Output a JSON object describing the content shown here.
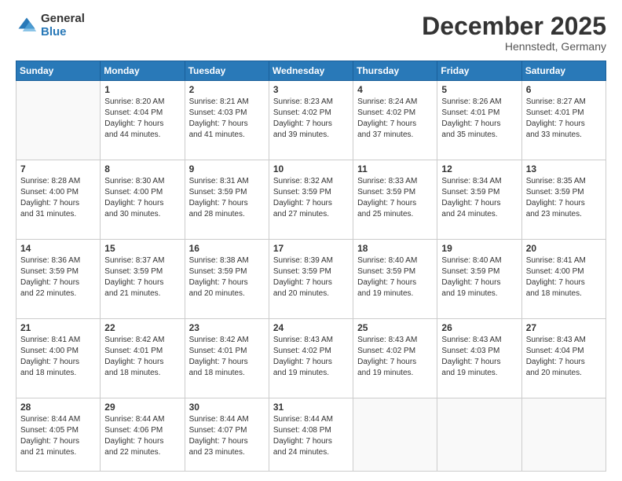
{
  "logo": {
    "general": "General",
    "blue": "Blue"
  },
  "header": {
    "month": "December 2025",
    "location": "Hennstedt, Germany"
  },
  "days": [
    "Sunday",
    "Monday",
    "Tuesday",
    "Wednesday",
    "Thursday",
    "Friday",
    "Saturday"
  ],
  "weeks": [
    [
      {
        "day": "",
        "content": ""
      },
      {
        "day": "1",
        "content": "Sunrise: 8:20 AM\nSunset: 4:04 PM\nDaylight: 7 hours\nand 44 minutes."
      },
      {
        "day": "2",
        "content": "Sunrise: 8:21 AM\nSunset: 4:03 PM\nDaylight: 7 hours\nand 41 minutes."
      },
      {
        "day": "3",
        "content": "Sunrise: 8:23 AM\nSunset: 4:02 PM\nDaylight: 7 hours\nand 39 minutes."
      },
      {
        "day": "4",
        "content": "Sunrise: 8:24 AM\nSunset: 4:02 PM\nDaylight: 7 hours\nand 37 minutes."
      },
      {
        "day": "5",
        "content": "Sunrise: 8:26 AM\nSunset: 4:01 PM\nDaylight: 7 hours\nand 35 minutes."
      },
      {
        "day": "6",
        "content": "Sunrise: 8:27 AM\nSunset: 4:01 PM\nDaylight: 7 hours\nand 33 minutes."
      }
    ],
    [
      {
        "day": "7",
        "content": "Sunrise: 8:28 AM\nSunset: 4:00 PM\nDaylight: 7 hours\nand 31 minutes."
      },
      {
        "day": "8",
        "content": "Sunrise: 8:30 AM\nSunset: 4:00 PM\nDaylight: 7 hours\nand 30 minutes."
      },
      {
        "day": "9",
        "content": "Sunrise: 8:31 AM\nSunset: 3:59 PM\nDaylight: 7 hours\nand 28 minutes."
      },
      {
        "day": "10",
        "content": "Sunrise: 8:32 AM\nSunset: 3:59 PM\nDaylight: 7 hours\nand 27 minutes."
      },
      {
        "day": "11",
        "content": "Sunrise: 8:33 AM\nSunset: 3:59 PM\nDaylight: 7 hours\nand 25 minutes."
      },
      {
        "day": "12",
        "content": "Sunrise: 8:34 AM\nSunset: 3:59 PM\nDaylight: 7 hours\nand 24 minutes."
      },
      {
        "day": "13",
        "content": "Sunrise: 8:35 AM\nSunset: 3:59 PM\nDaylight: 7 hours\nand 23 minutes."
      }
    ],
    [
      {
        "day": "14",
        "content": "Sunrise: 8:36 AM\nSunset: 3:59 PM\nDaylight: 7 hours\nand 22 minutes."
      },
      {
        "day": "15",
        "content": "Sunrise: 8:37 AM\nSunset: 3:59 PM\nDaylight: 7 hours\nand 21 minutes."
      },
      {
        "day": "16",
        "content": "Sunrise: 8:38 AM\nSunset: 3:59 PM\nDaylight: 7 hours\nand 20 minutes."
      },
      {
        "day": "17",
        "content": "Sunrise: 8:39 AM\nSunset: 3:59 PM\nDaylight: 7 hours\nand 20 minutes."
      },
      {
        "day": "18",
        "content": "Sunrise: 8:40 AM\nSunset: 3:59 PM\nDaylight: 7 hours\nand 19 minutes."
      },
      {
        "day": "19",
        "content": "Sunrise: 8:40 AM\nSunset: 3:59 PM\nDaylight: 7 hours\nand 19 minutes."
      },
      {
        "day": "20",
        "content": "Sunrise: 8:41 AM\nSunset: 4:00 PM\nDaylight: 7 hours\nand 18 minutes."
      }
    ],
    [
      {
        "day": "21",
        "content": "Sunrise: 8:41 AM\nSunset: 4:00 PM\nDaylight: 7 hours\nand 18 minutes."
      },
      {
        "day": "22",
        "content": "Sunrise: 8:42 AM\nSunset: 4:01 PM\nDaylight: 7 hours\nand 18 minutes."
      },
      {
        "day": "23",
        "content": "Sunrise: 8:42 AM\nSunset: 4:01 PM\nDaylight: 7 hours\nand 18 minutes."
      },
      {
        "day": "24",
        "content": "Sunrise: 8:43 AM\nSunset: 4:02 PM\nDaylight: 7 hours\nand 19 minutes."
      },
      {
        "day": "25",
        "content": "Sunrise: 8:43 AM\nSunset: 4:02 PM\nDaylight: 7 hours\nand 19 minutes."
      },
      {
        "day": "26",
        "content": "Sunrise: 8:43 AM\nSunset: 4:03 PM\nDaylight: 7 hours\nand 19 minutes."
      },
      {
        "day": "27",
        "content": "Sunrise: 8:43 AM\nSunset: 4:04 PM\nDaylight: 7 hours\nand 20 minutes."
      }
    ],
    [
      {
        "day": "28",
        "content": "Sunrise: 8:44 AM\nSunset: 4:05 PM\nDaylight: 7 hours\nand 21 minutes."
      },
      {
        "day": "29",
        "content": "Sunrise: 8:44 AM\nSunset: 4:06 PM\nDaylight: 7 hours\nand 22 minutes."
      },
      {
        "day": "30",
        "content": "Sunrise: 8:44 AM\nSunset: 4:07 PM\nDaylight: 7 hours\nand 23 minutes."
      },
      {
        "day": "31",
        "content": "Sunrise: 8:44 AM\nSunset: 4:08 PM\nDaylight: 7 hours\nand 24 minutes."
      },
      {
        "day": "",
        "content": ""
      },
      {
        "day": "",
        "content": ""
      },
      {
        "day": "",
        "content": ""
      }
    ]
  ]
}
